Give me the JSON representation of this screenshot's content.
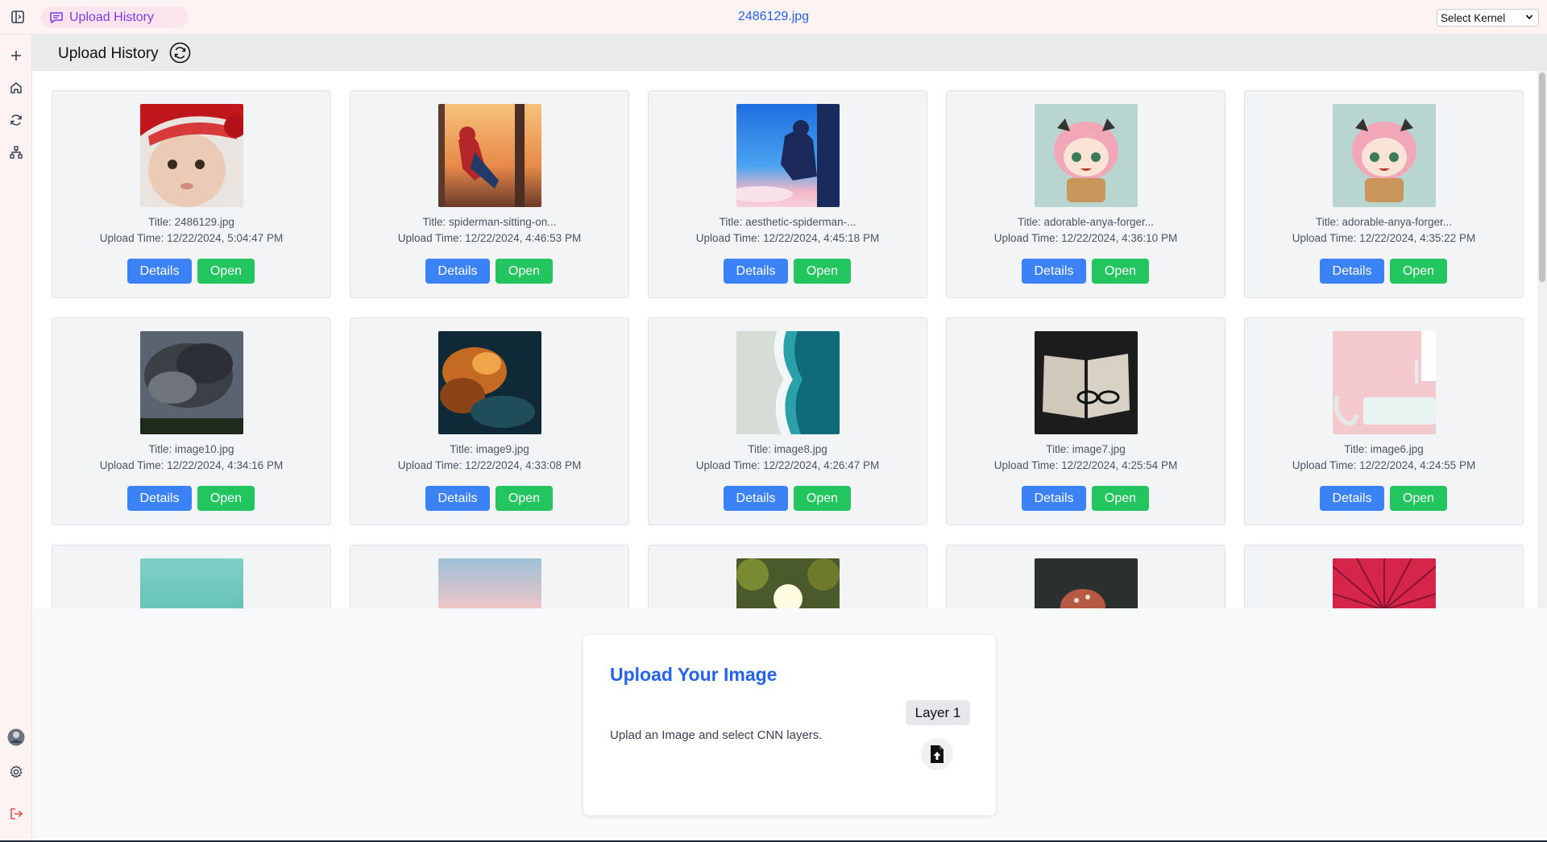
{
  "topbar": {
    "tab_label": "Upload History",
    "file_title": "2486129.jpg",
    "kernel_select": "Select Kernel"
  },
  "sidebar": {
    "icons": [
      "plus-icon",
      "home-icon",
      "refresh-icon",
      "network-icon",
      "avatar",
      "gear-icon",
      "logout-icon"
    ]
  },
  "history": {
    "title": "Upload History",
    "details_label": "Details",
    "open_label": "Open",
    "items": [
      {
        "title": "Title: 2486129.jpg",
        "time": "Upload Time: 12/22/2024, 5:04:47 PM"
      },
      {
        "title": "Title: spiderman-sitting-on...",
        "time": "Upload Time: 12/22/2024, 4:46:53 PM"
      },
      {
        "title": "Title: aesthetic-spiderman-...",
        "time": "Upload Time: 12/22/2024, 4:45:18 PM"
      },
      {
        "title": "Title: adorable-anya-forger...",
        "time": "Upload Time: 12/22/2024, 4:36:10 PM"
      },
      {
        "title": "Title: adorable-anya-forger...",
        "time": "Upload Time: 12/22/2024, 4:35:22 PM"
      },
      {
        "title": "Title: image10.jpg",
        "time": "Upload Time: 12/22/2024, 4:34:16 PM"
      },
      {
        "title": "Title: image9.jpg",
        "time": "Upload Time: 12/22/2024, 4:33:08 PM"
      },
      {
        "title": "Title: image8.jpg",
        "time": "Upload Time: 12/22/2024, 4:26:47 PM"
      },
      {
        "title": "Title: image7.jpg",
        "time": "Upload Time: 12/22/2024, 4:25:54 PM"
      },
      {
        "title": "Title: image6.jpg",
        "time": "Upload Time: 12/22/2024, 4:24:55 PM"
      }
    ]
  },
  "upload": {
    "title": "Upload Your Image",
    "description": "Uplad an Image and select CNN layers.",
    "layer_label": "Layer 1"
  },
  "colors": {
    "accent": "#2563eb",
    "details_button": "#3b82f6",
    "open_button": "#22c55e",
    "tab_text": "#7c3aed"
  }
}
